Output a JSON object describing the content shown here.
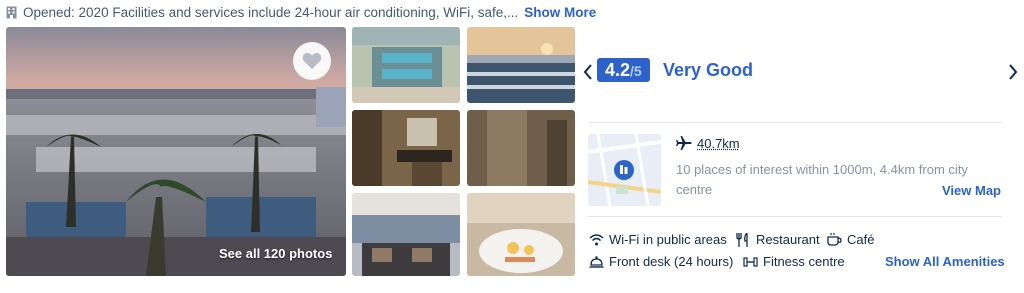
{
  "summary": {
    "text": "Opened: 2020 Facilities and services include 24-hour air conditioning, WiFi, safe,...",
    "show_more_label": "Show More",
    "building_icon": "building-icon"
  },
  "gallery": {
    "see_all_label": "See all 120 photos",
    "favorite_icon": "heart-icon",
    "thumbnails": [
      {
        "subject": "aerial resort view"
      },
      {
        "subject": "pool at sunset"
      },
      {
        "subject": "bathroom"
      },
      {
        "subject": "room interior"
      },
      {
        "subject": "lounge"
      },
      {
        "subject": "breakfast buffet"
      }
    ]
  },
  "rating": {
    "score": "4.2",
    "scale": "/5",
    "label": "Very Good",
    "prev_icon": "chevron-left-icon",
    "next_icon": "chevron-right-icon"
  },
  "location": {
    "map_icon": "map-pin-icon",
    "airport_icon": "plane-icon",
    "distance": "40.7km",
    "description": "10 places of interest within 1000m, 4.4km from city centre",
    "view_map_label": "View Map"
  },
  "amenities": {
    "items": [
      {
        "label": "Wi-Fi in public areas",
        "icon": "wifi-icon"
      },
      {
        "label": "Restaurant",
        "icon": "restaurant-icon"
      },
      {
        "label": "Café",
        "icon": "cafe-icon"
      },
      {
        "label": "Front desk (24 hours)",
        "icon": "front-desk-icon"
      },
      {
        "label": "Fitness centre",
        "icon": "dumbbell-icon"
      }
    ],
    "show_all_label": "Show All Amenities"
  },
  "colors": {
    "accent": "#2c62c9",
    "text": "#0f294d",
    "muted": "#8592a6"
  }
}
